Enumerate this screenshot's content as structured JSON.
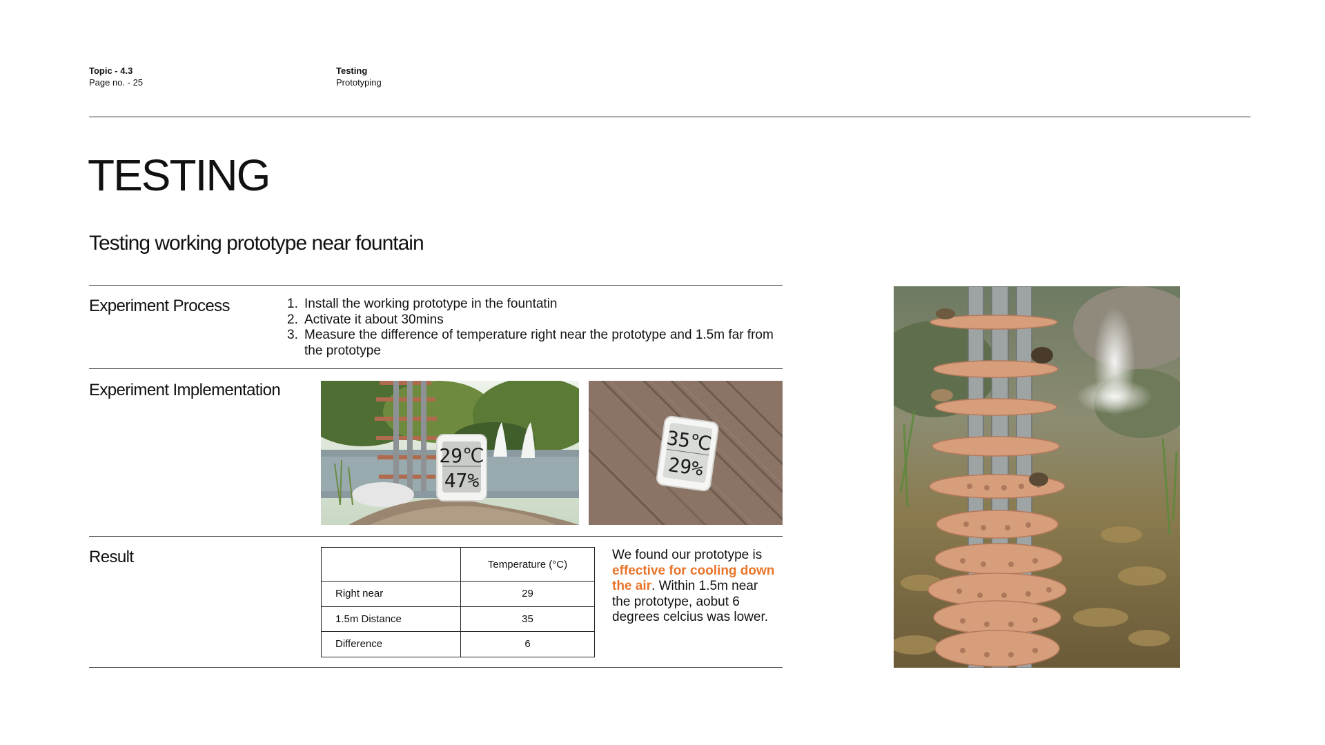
{
  "header": {
    "topic": "Topic - 4.3",
    "page_no": "Page no. - 25",
    "section": "Testing",
    "subsection": "Prototyping"
  },
  "title": "TESTING",
  "subtitle": "Testing working prototype near fountain",
  "experiment_process": {
    "label": "Experiment Process",
    "steps": [
      "Install the working prototype in the fountatin",
      "Activate it about 30mins",
      "Measure the difference of temperature right near the prototype and 1.5m far from the prototype"
    ]
  },
  "experiment_implementation": {
    "label": "Experiment Implementation",
    "photo_fountain": {
      "thermometer_temp": "29℃",
      "thermometer_humidity": "47%"
    },
    "photo_deck": {
      "thermometer_temp": "35℃",
      "thermometer_humidity": "29%"
    }
  },
  "result": {
    "label": "Result",
    "table": {
      "header": [
        "",
        "Temperature (°C)"
      ],
      "rows": [
        [
          "Right near",
          "29"
        ],
        [
          "1.5m Distance",
          "35"
        ],
        [
          "Difference",
          "6"
        ]
      ]
    },
    "text_before": "We found our prototype is ",
    "text_highlight": "effective for cooling down the air",
    "text_after": ". Within 1.5m near the prototype, aobut 6 degrees celcius was lower."
  },
  "colors": {
    "highlight": "#e8742a",
    "text": "#111111",
    "rule": "#444444"
  }
}
